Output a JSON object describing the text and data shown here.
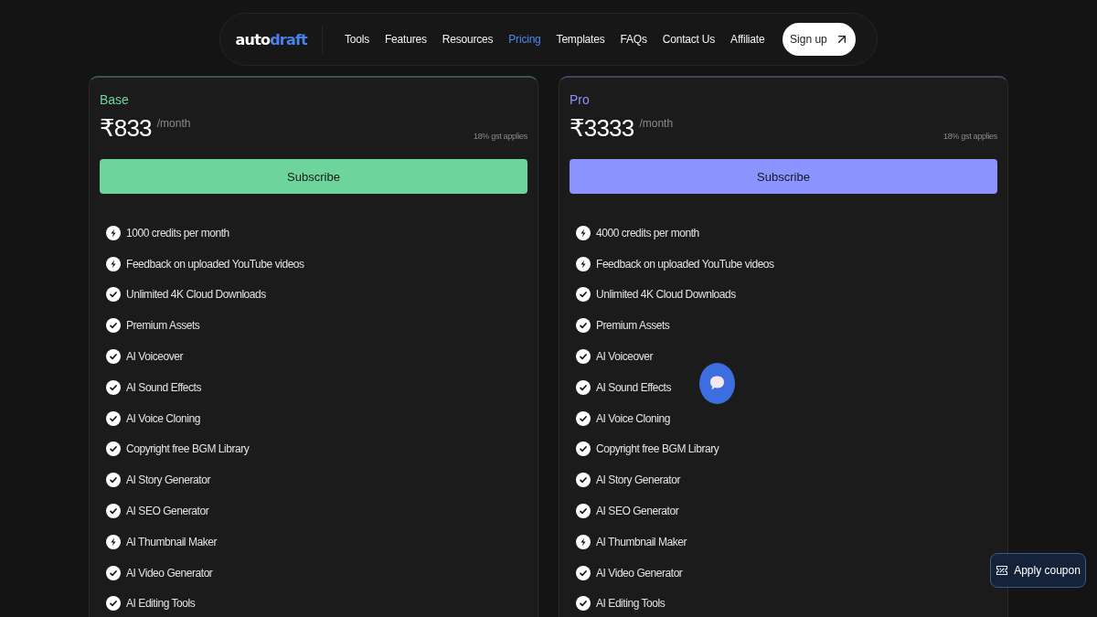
{
  "nav": {
    "logo": {
      "prefix": "auto",
      "accent": "draft"
    },
    "links": [
      {
        "label": "Tools",
        "selected": false
      },
      {
        "label": "Features",
        "selected": false
      },
      {
        "label": "Resources",
        "selected": false
      },
      {
        "label": "Pricing",
        "selected": true
      },
      {
        "label": "Templates",
        "selected": false
      },
      {
        "label": "FAQs",
        "selected": false
      },
      {
        "label": "Contact Us",
        "selected": false
      },
      {
        "label": "Affiliate",
        "selected": false
      }
    ],
    "cta": "Sign up"
  },
  "plans": [
    {
      "name": "Base",
      "color": "#6dd59b",
      "price": "₹833",
      "period": "/month",
      "tax_note": "18% gst applies",
      "button": "Subscribe",
      "features": [
        {
          "kind": "bolt",
          "text": "1000 credits per month"
        },
        {
          "kind": "bolt",
          "text": "Feedback on uploaded YouTube videos"
        },
        {
          "kind": "check",
          "text": "Unlimited 4K Cloud Downloads"
        },
        {
          "kind": "check",
          "text": "Premium Assets"
        },
        {
          "kind": "check",
          "text": "AI Voiceover"
        },
        {
          "kind": "check",
          "text": "AI Sound Effects"
        },
        {
          "kind": "check",
          "text": "AI Voice Cloning"
        },
        {
          "kind": "check",
          "text": "Copyright free BGM Library"
        },
        {
          "kind": "check",
          "text": "AI Story Generator"
        },
        {
          "kind": "check",
          "text": "AI SEO Generator"
        },
        {
          "kind": "bolt",
          "text": "AI Thumbnail Maker"
        },
        {
          "kind": "check",
          "text": "AI Video Generator"
        },
        {
          "kind": "check",
          "text": "AI Editing Tools"
        }
      ]
    },
    {
      "name": "Pro",
      "color": "#8b93ff",
      "price": "₹3333",
      "period": "/month",
      "tax_note": "18% gst applies",
      "button": "Subscribe",
      "features": [
        {
          "kind": "bolt",
          "text": "4000 credits per month"
        },
        {
          "kind": "bolt",
          "text": "Feedback on uploaded YouTube videos"
        },
        {
          "kind": "check",
          "text": "Unlimited 4K Cloud Downloads"
        },
        {
          "kind": "check",
          "text": "Premium Assets"
        },
        {
          "kind": "check",
          "text": "AI Voiceover"
        },
        {
          "kind": "check",
          "text": "AI Sound Effects"
        },
        {
          "kind": "check",
          "text": "AI Voice Cloning"
        },
        {
          "kind": "check",
          "text": "Copyright free BGM Library"
        },
        {
          "kind": "check",
          "text": "AI Story Generator"
        },
        {
          "kind": "check",
          "text": "AI SEO Generator"
        },
        {
          "kind": "bolt",
          "text": "AI Thumbnail Maker"
        },
        {
          "kind": "check",
          "text": "AI Video Generator"
        },
        {
          "kind": "check",
          "text": "AI Editing Tools"
        }
      ]
    }
  ],
  "coupon_button": "Apply coupon"
}
